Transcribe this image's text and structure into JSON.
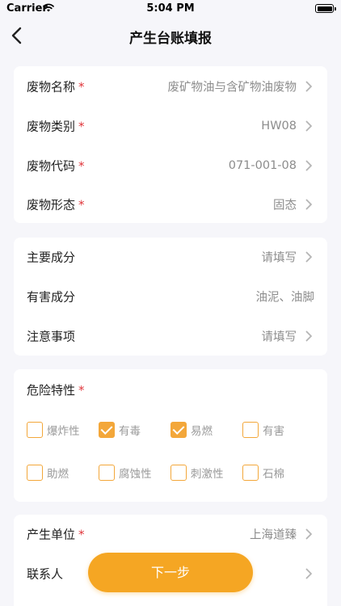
{
  "status_bar": {
    "carrier": "Carrier",
    "time": "5:04 PM"
  },
  "nav": {
    "title": "产生台账填报"
  },
  "waste_info": [
    {
      "label": "废物名称",
      "required": true,
      "value": "废矿物油与含矿物油废物",
      "has_arrow": true
    },
    {
      "label": "废物类别",
      "required": true,
      "value": "HW08",
      "has_arrow": true
    },
    {
      "label": "废物代码",
      "required": true,
      "value": "071-001-08",
      "has_arrow": true
    },
    {
      "label": "废物形态",
      "required": true,
      "value": "固态",
      "has_arrow": true
    }
  ],
  "composition": [
    {
      "label": "主要成分",
      "required": false,
      "value": "请填写",
      "has_arrow": true
    },
    {
      "label": "有害成分",
      "required": false,
      "value": "油泥、油脚",
      "has_arrow": false
    },
    {
      "label": "注意事项",
      "required": false,
      "value": "请填写",
      "has_arrow": true
    }
  ],
  "hazard": {
    "title": "危险特性",
    "required": true,
    "options": [
      {
        "label": "爆炸性",
        "checked": false
      },
      {
        "label": "有毒",
        "checked": true
      },
      {
        "label": "易燃",
        "checked": true
      },
      {
        "label": "有害",
        "checked": false
      },
      {
        "label": "助燃",
        "checked": false
      },
      {
        "label": "腐蚀性",
        "checked": false
      },
      {
        "label": "刺激性",
        "checked": false
      },
      {
        "label": "石棉",
        "checked": false
      }
    ]
  },
  "unit_info": [
    {
      "label": "产生单位",
      "required": true,
      "value": "上海道臻",
      "has_arrow": true
    },
    {
      "label": "联系人",
      "required": false,
      "value": "",
      "has_arrow": true
    }
  ],
  "next_button": {
    "label": "下一步"
  },
  "colors": {
    "accent": "#f5a623",
    "required": "#e0393e",
    "background": "#f6f6fa"
  }
}
